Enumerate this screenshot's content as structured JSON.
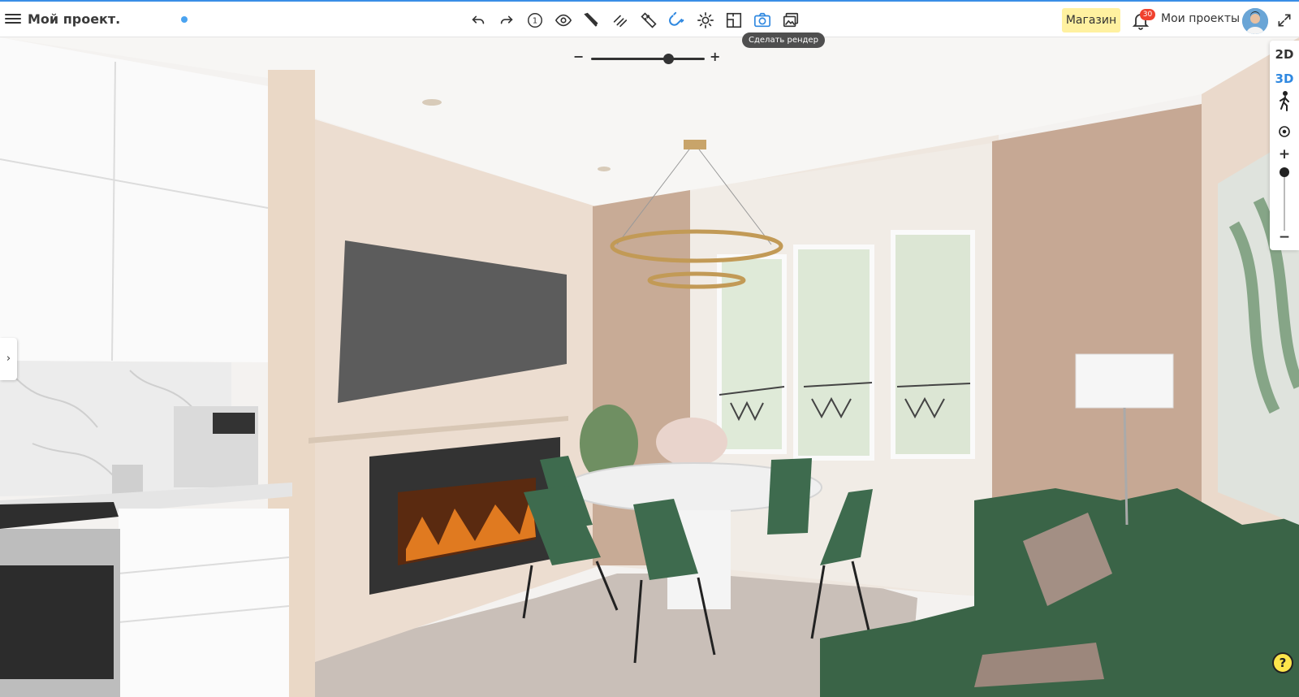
{
  "header": {
    "project_title": "Мой проект.",
    "tooltip_render": "Сделать рендер",
    "shop_label": "Магазин",
    "notifications_count": "30",
    "my_projects_label": "Мои проекты"
  },
  "toolbar": {
    "tools": [
      {
        "icon": "undo-icon"
      },
      {
        "icon": "redo-icon"
      },
      {
        "icon": "floor-number-icon",
        "label": "1"
      },
      {
        "icon": "eye-icon"
      },
      {
        "icon": "pencil-icon"
      },
      {
        "icon": "wall-draw-icon"
      },
      {
        "icon": "ruler-icon"
      },
      {
        "icon": "magnet-icon",
        "active": true
      },
      {
        "icon": "sun-icon"
      },
      {
        "icon": "plan-icon"
      },
      {
        "icon": "camera-icon",
        "active": true
      },
      {
        "icon": "gallery-icon"
      }
    ]
  },
  "zoom": {
    "level": 0.68
  },
  "view_panel": {
    "mode_2d": "2D",
    "mode_3d": "3D",
    "active_mode": "3D",
    "plus": "+",
    "minus": "−",
    "vertical_level": 1.0
  },
  "help": {
    "label": "?"
  },
  "colors": {
    "accent": "#2f88e0",
    "shop_bg": "#fff1a0",
    "badge": "#f0412e",
    "help_bg": "#fde54b"
  }
}
